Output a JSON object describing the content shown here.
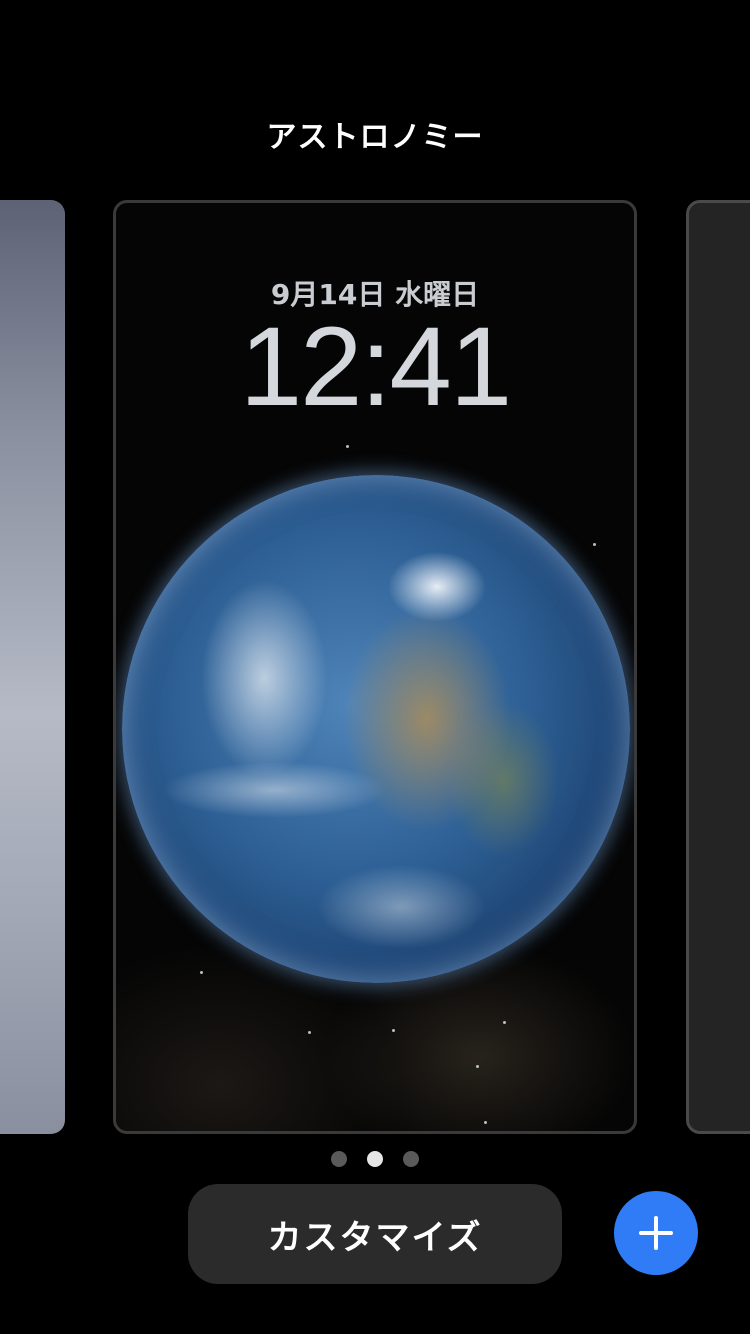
{
  "header": {
    "title": "アストロノミー"
  },
  "lockscreen": {
    "date": "9月14日 水曜日",
    "time": "12:41"
  },
  "pager": {
    "count": 3,
    "active": 2
  },
  "actions": {
    "customize_label": "カスタマイズ",
    "add_icon": "plus-icon"
  },
  "colors": {
    "accent": "#2f7cf6",
    "button_bg": "#2b2b2b",
    "background": "#000000"
  }
}
